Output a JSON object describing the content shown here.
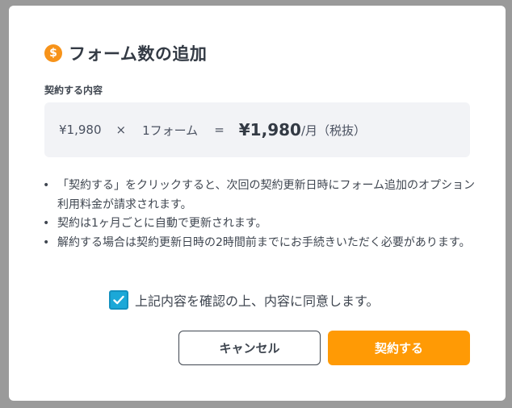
{
  "dialog": {
    "title": "フォーム数の追加",
    "title_icon": "dollar-coin-icon",
    "section_label": "契約する内容",
    "calc": {
      "unit_price": "¥1,980",
      "times": "×",
      "quantity": "1フォーム",
      "equals": "=",
      "total": "¥1,980",
      "per_note": "/月（税抜）"
    },
    "notes": [
      "「契約する」をクリックすると、次回の契約更新日時にフォーム追加のオプション利用料金が請求されます。",
      "契約は1ヶ月ごとに自動で更新されます。",
      "解約する場合は契約更新日時の2時間前までにお手続きいただく必要があります。"
    ],
    "agree_label": "上記内容を確認の上、内容に同意します。",
    "agree_checked": true,
    "cancel_label": "キャンセル",
    "contract_label": "契約する"
  },
  "colors": {
    "accent": "#ff9a05",
    "checkbox": "#1ba8d8",
    "coin": "#f7931a"
  }
}
